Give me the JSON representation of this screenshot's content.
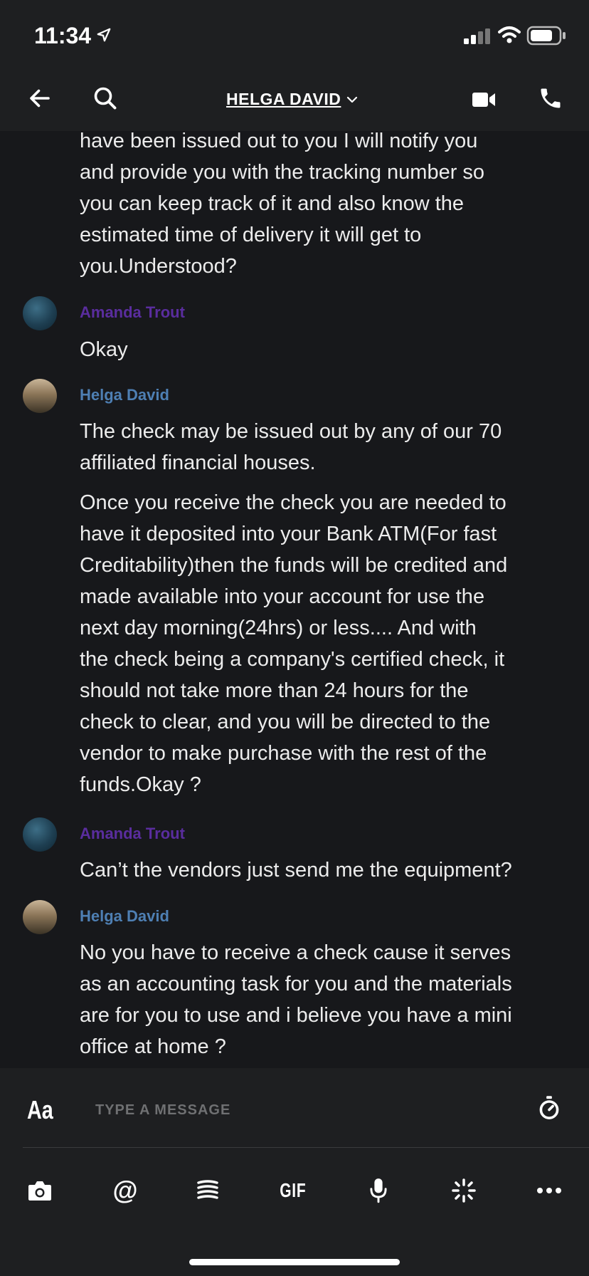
{
  "status": {
    "time": "11:34"
  },
  "header": {
    "title": "HELGA DAVID"
  },
  "messages": {
    "m0": "have been issued out to you I will notify  you\nand provide you with the tracking  number so\nyou can  keep track of it and  also know the\nestimated time of delivery it will get to\nyou.Understood?",
    "s1": "Amanda Trout",
    "m1": "Okay",
    "s2": "Helga David",
    "m2a": "The check may be issued out by any of our 70\naffiliated financial houses.",
    "m2b": "Once you receive the check you are needed  to\nhave it deposited into your Bank ATM(For fast\nCreditability)then the funds will be credited and\n made available into your account for use the\nnext  day morning(24hrs) or less.... And with\nthe check being a company's certified check, it\nshould not take more than 24 hours for the\ncheck to clear, and you will be directed to the\nvendor to make purchase with the rest of the\nfunds.Okay ?",
    "s3": "Amanda Trout",
    "m3": "Can’t the vendors just send me the equipment?",
    "s4": "Helga David",
    "m4": "No you have to receive a check cause it serves\nas an accounting task for you and the materials\nare for you to use and i believe you have a mini\noffice at home ?"
  },
  "composer": {
    "aa": "Aa",
    "placeholder": "TYPE A MESSAGE",
    "gif": "GIF",
    "at": "@"
  }
}
